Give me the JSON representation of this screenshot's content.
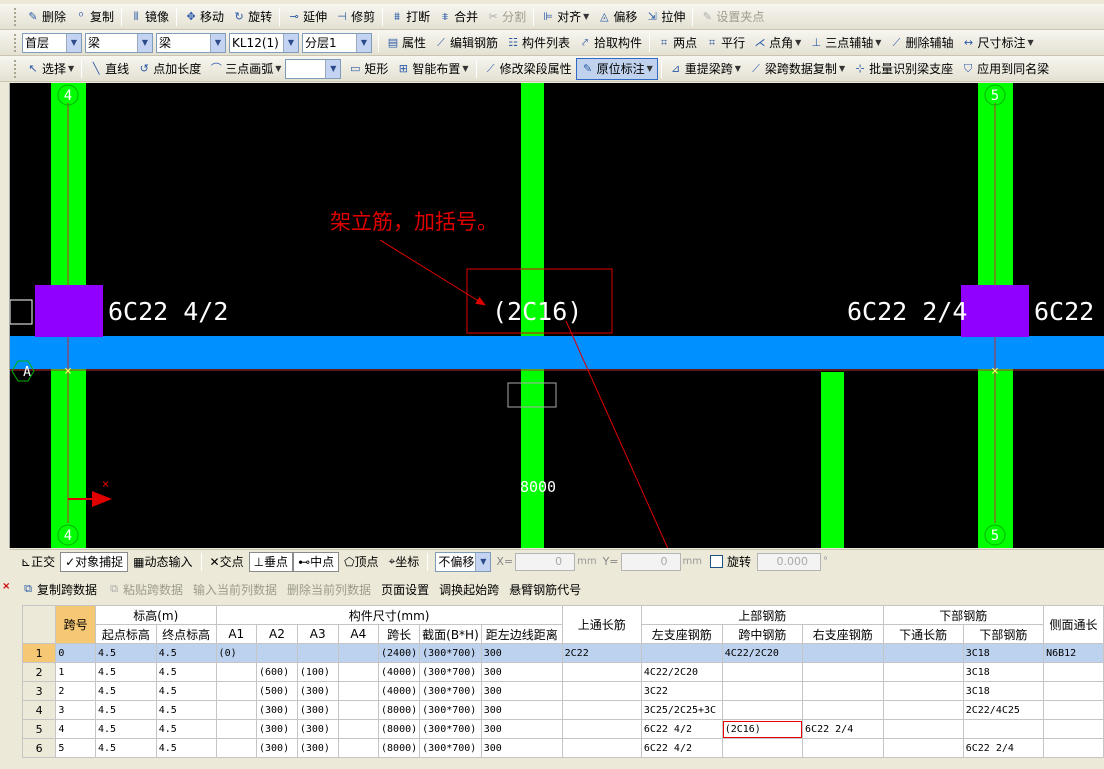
{
  "toolbar1": [
    {
      "label": "删除",
      "icon": "✎",
      "icon_name": "delete-icon"
    },
    {
      "label": "复制",
      "icon": "⁰",
      "icon_name": "copy-icon"
    },
    {
      "label": "镜像",
      "icon": "⫴",
      "icon_name": "mirror-icon"
    },
    {
      "label": "移动",
      "icon": "✥",
      "icon_name": "move-icon"
    },
    {
      "label": "旋转",
      "icon": "↻",
      "icon_name": "rotate-icon"
    },
    {
      "label": "延伸",
      "icon": "⊸",
      "icon_name": "extend-icon"
    },
    {
      "label": "修剪",
      "icon": "⊣",
      "icon_name": "trim-icon"
    },
    {
      "label": "打断",
      "icon": "⩩",
      "icon_name": "break-icon"
    },
    {
      "label": "合并",
      "icon": "⩨",
      "icon_name": "merge-icon"
    },
    {
      "label": "分割",
      "icon": "✂",
      "icon_name": "split-icon",
      "disabled": true
    },
    {
      "label": "对齐",
      "icon": "⊫",
      "icon_name": "align-icon",
      "dropdown": true
    },
    {
      "label": "偏移",
      "icon": "◬",
      "icon_name": "offset-icon"
    },
    {
      "label": "拉伸",
      "icon": "⇲",
      "icon_name": "stretch-icon"
    },
    {
      "label": "设置夹点",
      "icon": "✎",
      "icon_name": "grip-icon",
      "disabled": true
    }
  ],
  "toolbar2": {
    "floor": "首层",
    "category": "梁",
    "type": "梁",
    "element": "KL12(1)",
    "layer": "分层1",
    "buttons": [
      {
        "label": "属性",
        "icon": "▤",
        "icon_name": "property-icon"
      },
      {
        "label": "编辑钢筋",
        "icon": "⟋",
        "icon_name": "edit-rebar-icon"
      },
      {
        "label": "构件列表",
        "icon": "☷",
        "icon_name": "component-list-icon"
      },
      {
        "label": "拾取构件",
        "icon": "⤤",
        "icon_name": "pick-component-icon"
      },
      {
        "label": "两点",
        "icon": "⌗",
        "icon_name": "two-point-icon"
      },
      {
        "label": "平行",
        "icon": "⌗",
        "icon_name": "parallel-icon"
      },
      {
        "label": "点角",
        "icon": "⋌",
        "icon_name": "point-angle-icon",
        "dropdown": true
      },
      {
        "label": "三点辅轴",
        "icon": "⊥",
        "icon_name": "three-point-axis-icon",
        "dropdown": true
      },
      {
        "label": "删除辅轴",
        "icon": "⟋",
        "icon_name": "delete-axis-icon"
      },
      {
        "label": "尺寸标注",
        "icon": "↔",
        "icon_name": "dimension-icon",
        "dropdown": true
      }
    ]
  },
  "toolbar3": {
    "buttons_a": [
      {
        "label": "选择",
        "icon": "↖",
        "icon_name": "select-icon",
        "dropdown": true
      },
      {
        "label": "直线",
        "icon": "╲",
        "icon_name": "line-icon"
      },
      {
        "label": "点加长度",
        "icon": "↺",
        "icon_name": "point-length-icon"
      },
      {
        "label": "三点画弧",
        "icon": "⌒",
        "icon_name": "arc-icon",
        "dropdown": true
      }
    ],
    "buttons_b": [
      {
        "label": "矩形",
        "icon": "▭",
        "icon_name": "rectangle-icon"
      },
      {
        "label": "智能布置",
        "icon": "⊞",
        "icon_name": "smart-layout-icon",
        "dropdown": true
      },
      {
        "label": "修改梁段属性",
        "icon": "⟋",
        "icon_name": "modify-segment-icon"
      },
      {
        "label": "原位标注",
        "icon": "✎",
        "icon_name": "in-situ-label-icon",
        "dropdown": true,
        "active": true
      },
      {
        "label": "重提梁跨",
        "icon": "⊿",
        "icon_name": "re-extract-span-icon",
        "dropdown": true
      },
      {
        "label": "梁跨数据复制",
        "icon": "⟋",
        "icon_name": "span-copy-icon",
        "dropdown": true
      },
      {
        "label": "批量识别梁支座",
        "icon": "⊹",
        "icon_name": "batch-support-icon"
      },
      {
        "label": "应用到同名梁",
        "icon": "⛉",
        "icon_name": "apply-same-name-icon"
      }
    ]
  },
  "canvas": {
    "axis_labels": [
      "4",
      "5",
      "4",
      "5",
      "A"
    ],
    "annotation_text": "架立筋，加括号。",
    "left_rebar": "6C22 4/2",
    "mid_rebar": "(2C16)",
    "right_rebar": "6C22 2/4",
    "right_rebar_2": "6C22",
    "span_length": "8000"
  },
  "statusbar": {
    "buttons": [
      {
        "label": "正交",
        "icon": "⊾",
        "icon_name": "ortho-icon"
      },
      {
        "label": "对象捕捉",
        "icon": "✓",
        "icon_name": "object-snap-icon",
        "pressed": true
      },
      {
        "label": "动态输入",
        "icon": "▦",
        "icon_name": "dynamic-input-icon"
      },
      {
        "label": "交点",
        "icon": "✕",
        "icon_name": "intersection-icon"
      },
      {
        "label": "垂点",
        "icon": "⊥",
        "icon_name": "perpendicular-icon",
        "pressed": true
      },
      {
        "label": "中点",
        "icon": "⊷",
        "icon_name": "midpoint-icon",
        "pressed": true
      },
      {
        "label": "顶点",
        "icon": "⬠",
        "icon_name": "vertex-icon"
      },
      {
        "label": "坐标",
        "icon": "⌖",
        "icon_name": "coordinate-icon"
      }
    ],
    "offset_mode": "不偏移",
    "x_label": "X=",
    "y_label": "Y=",
    "x_value": "0",
    "y_value": "0",
    "unit": "mm",
    "rotate_label": "旋转",
    "rotate_value": "0.000",
    "degree": "°"
  },
  "panel_buttons": [
    {
      "label": "复制跨数据",
      "icon": "⧉",
      "icon_name": "copy-span-icon"
    },
    {
      "label": "粘贴跨数据",
      "icon": "⧉",
      "icon_name": "paste-span-icon",
      "disabled": true
    },
    {
      "label": "输入当前列数据",
      "disabled": true
    },
    {
      "label": "删除当前列数据",
      "disabled": true
    },
    {
      "label": "页面设置"
    },
    {
      "label": "调换起始跨"
    },
    {
      "label": "悬臂钢筋代号"
    }
  ],
  "table": {
    "group_headers": {
      "span_no": "跨号",
      "elevation": "标高(m)",
      "dimension": "构件尺寸(mm)",
      "top_long": "上通长筋",
      "top_rebar": "上部钢筋",
      "bottom_rebar": "下部钢筋",
      "side": "侧面通长"
    },
    "sub_headers": [
      "起点标高",
      "终点标高",
      "A1",
      "A2",
      "A3",
      "A4",
      "跨长",
      "截面(B*H)",
      "距左边线距离",
      "左支座钢筋",
      "跨中钢筋",
      "右支座钢筋",
      "下通长筋",
      "下部钢筋"
    ],
    "rows": [
      {
        "n": "1",
        "span": "0",
        "start": "4.5",
        "end": "4.5",
        "a1": "(0)",
        "a2": "",
        "a3": "",
        "a4": "",
        "len": "(2400)",
        "sec": "(300*700)",
        "dist": "300",
        "toplong": "2C22",
        "left": "",
        "mid": "4C22/2C20",
        "right": "",
        "botlong": "",
        "bot": "3C18",
        "side": "N6B12"
      },
      {
        "n": "2",
        "span": "1",
        "start": "4.5",
        "end": "4.5",
        "a1": "",
        "a2": "(600)",
        "a3": "(100)",
        "a4": "",
        "len": "(4000)",
        "sec": "(300*700)",
        "dist": "300",
        "toplong": "",
        "left": "4C22/2C20",
        "mid": "",
        "right": "",
        "botlong": "",
        "bot": "3C18",
        "side": ""
      },
      {
        "n": "3",
        "span": "2",
        "start": "4.5",
        "end": "4.5",
        "a1": "",
        "a2": "(500)",
        "a3": "(300)",
        "a4": "",
        "len": "(4000)",
        "sec": "(300*700)",
        "dist": "300",
        "toplong": "",
        "left": "3C22",
        "mid": "",
        "right": "",
        "botlong": "",
        "bot": "3C18",
        "side": ""
      },
      {
        "n": "4",
        "span": "3",
        "start": "4.5",
        "end": "4.5",
        "a1": "",
        "a2": "(300)",
        "a3": "(300)",
        "a4": "",
        "len": "(8000)",
        "sec": "(300*700)",
        "dist": "300",
        "toplong": "",
        "left": "3C25/2C25+3C",
        "mid": "",
        "right": "",
        "botlong": "",
        "bot": "2C22/4C25",
        "side": ""
      },
      {
        "n": "5",
        "span": "4",
        "start": "4.5",
        "end": "4.5",
        "a1": "",
        "a2": "(300)",
        "a3": "(300)",
        "a4": "",
        "len": "(8000)",
        "sec": "(300*700)",
        "dist": "300",
        "toplong": "",
        "left": "6C22 4/2",
        "mid": "(2C16)",
        "right": "6C22 2/4",
        "botlong": "",
        "bot": "",
        "side": ""
      },
      {
        "n": "6",
        "span": "5",
        "start": "4.5",
        "end": "4.5",
        "a1": "",
        "a2": "(300)",
        "a3": "(300)",
        "a4": "",
        "len": "(8000)",
        "sec": "(300*700)",
        "dist": "300",
        "toplong": "",
        "left": "6C22 4/2",
        "mid": "",
        "right": "",
        "botlong": "",
        "bot": "6C22 2/4",
        "side": ""
      }
    ]
  },
  "colors": {
    "column_green": "#00ff00",
    "beam_blue": "#0090ff",
    "support_purple": "#9000ff",
    "annotation_red": "#e00000",
    "axis_green": "#00b000"
  }
}
